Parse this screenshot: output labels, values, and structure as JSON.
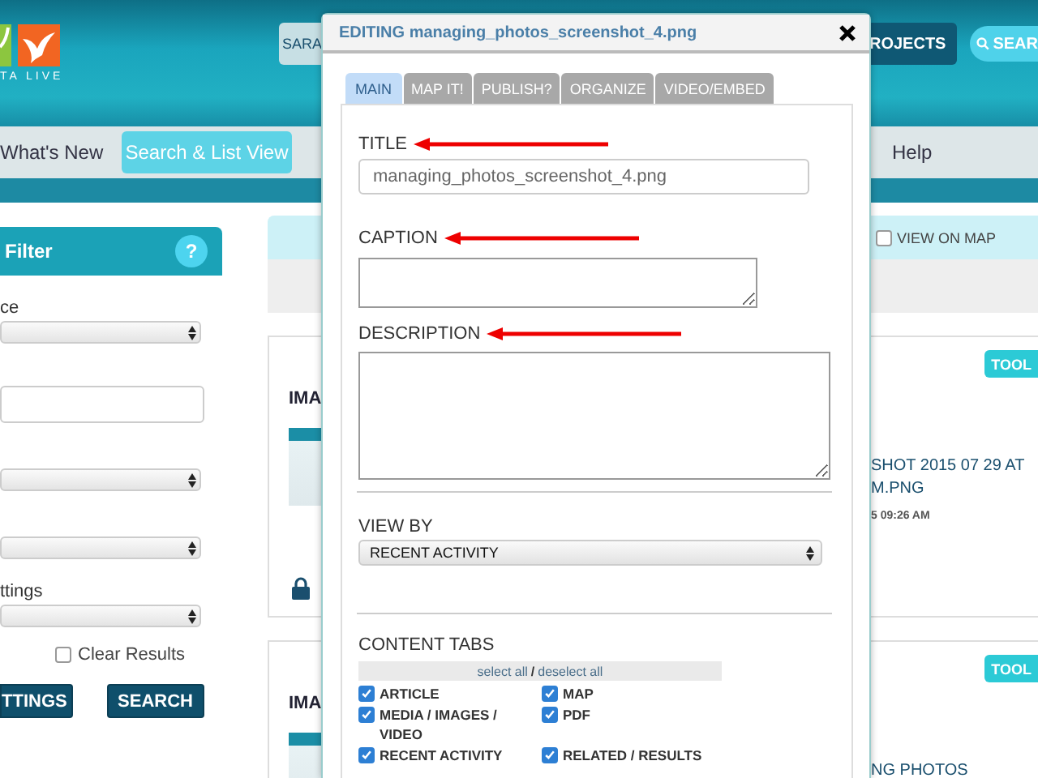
{
  "header": {
    "logo_text": "TA LIVE",
    "user_button": "SARA",
    "projects_button": "ROJECTS",
    "search_button": "SEAR"
  },
  "nav": [
    {
      "label": "What's New",
      "selected": false
    },
    {
      "label": "Search & List View",
      "selected": true
    },
    {
      "label": "Help",
      "selected": false
    }
  ],
  "filter": {
    "title": "Filter",
    "help": "?",
    "fields": [
      {
        "kind": "select",
        "label": "ce"
      },
      {
        "kind": "text"
      },
      {
        "kind": "select"
      },
      {
        "kind": "select"
      },
      {
        "kind": "select",
        "label": "ttings"
      }
    ],
    "clear_results": {
      "label": "Clear Results",
      "checked": false
    },
    "buttons": [
      "TTINGS",
      "SEARCH"
    ]
  },
  "results": {
    "view_on_map": {
      "label": "VIEW ON MAP",
      "checked": false
    },
    "cards": [
      {
        "type_label": "IMA",
        "badge": "TOOL",
        "title_lines": [
          "SHOT 2015 07 29 AT",
          "M.PNG"
        ],
        "date": "5 09:26 AM",
        "locked": true
      },
      {
        "type_label": "IMA",
        "badge": "TOOL",
        "title_lines": [
          "NG PHOTOS"
        ],
        "locked": false
      }
    ]
  },
  "modal": {
    "title": "EDITING managing_photos_screenshot_4.png",
    "tabs": [
      {
        "label": "MAIN",
        "selected": true
      },
      {
        "label": "MAP IT!",
        "selected": false
      },
      {
        "label": "PUBLISH?",
        "selected": false
      },
      {
        "label": "ORGANIZE",
        "selected": false
      },
      {
        "label": "VIDEO/EMBED",
        "selected": false
      }
    ],
    "fields": [
      {
        "kind": "input",
        "label": "TITLE",
        "value": "managing_photos_screenshot_4.png",
        "annotated": true
      },
      {
        "kind": "short_textarea",
        "label": "CAPTION",
        "annotated": true
      },
      {
        "kind": "long_textarea",
        "label": "DESCRIPTION",
        "annotated": true
      }
    ],
    "view_by": {
      "label": "VIEW BY",
      "value": "RECENT ACTIVITY"
    },
    "content_tabs": {
      "label": "CONTENT TABS",
      "select_all": "select all",
      "separator": "/",
      "deselect_all": "deselect all",
      "items": [
        {
          "label": "ARTICLE",
          "checked": true
        },
        {
          "label": "MAP",
          "checked": true
        },
        {
          "label": "MEDIA / IMAGES / VIDEO",
          "checked": true
        },
        {
          "label": "PDF",
          "checked": true
        },
        {
          "label": "RECENT ACTIVITY",
          "checked": true
        },
        {
          "label": "RELATED / RESULTS",
          "checked": true
        }
      ]
    }
  }
}
